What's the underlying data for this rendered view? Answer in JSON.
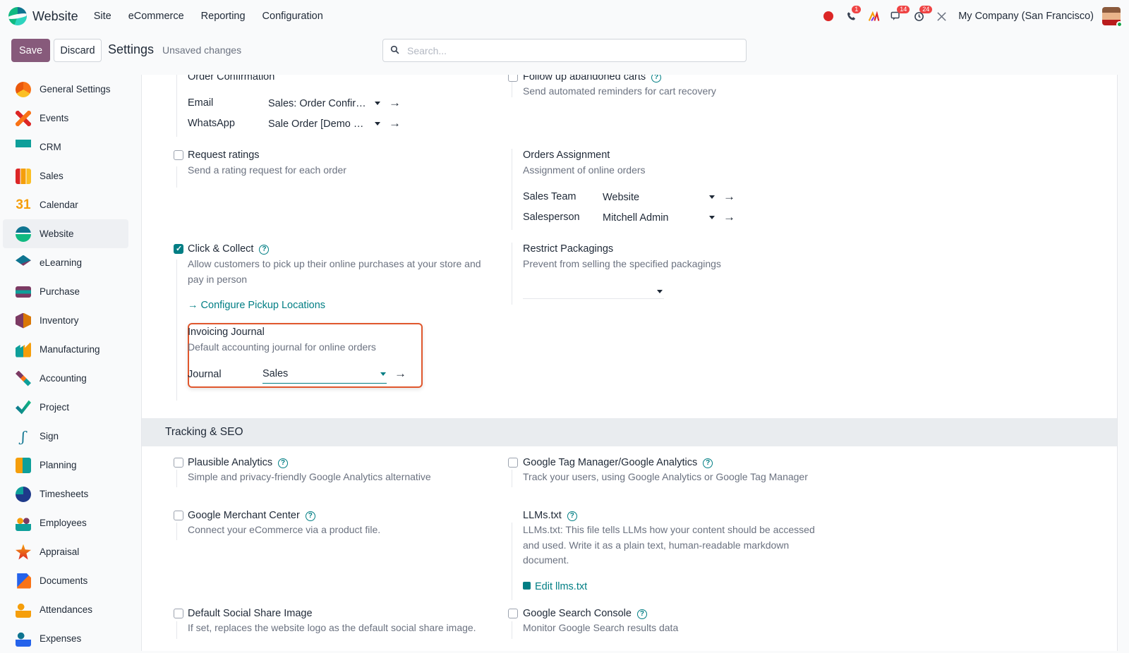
{
  "navbar": {
    "app_name": "Website",
    "menu": [
      "Site",
      "eCommerce",
      "Reporting",
      "Configuration"
    ],
    "badges": {
      "phone": "1",
      "messages": "14",
      "activities": "24"
    },
    "company": "My Company (San Francisco)"
  },
  "control_panel": {
    "save_label": "Save",
    "discard_label": "Discard",
    "title": "Settings",
    "status": "Unsaved changes",
    "search_placeholder": "Search..."
  },
  "sidebar": {
    "items": [
      {
        "label": "General Settings",
        "icon": "general-settings-icon",
        "color": "#f97316"
      },
      {
        "label": "Events",
        "icon": "events-icon",
        "color": "#f97316"
      },
      {
        "label": "CRM",
        "icon": "crm-icon",
        "color": "#0e9f9a"
      },
      {
        "label": "Sales",
        "icon": "sales-icon",
        "color": "#f59e0b"
      },
      {
        "label": "Calendar",
        "icon": "calendar-icon",
        "color": "#f59e0b"
      },
      {
        "label": "Website",
        "icon": "website-icon",
        "color": "#10b981",
        "active": true
      },
      {
        "label": "eLearning",
        "icon": "elearning-icon",
        "color": "#0e7490"
      },
      {
        "label": "Purchase",
        "icon": "purchase-icon",
        "color": "#7c3a63"
      },
      {
        "label": "Inventory",
        "icon": "inventory-icon",
        "color": "#d97706"
      },
      {
        "label": "Manufacturing",
        "icon": "manufacturing-icon",
        "color": "#0e9f9a"
      },
      {
        "label": "Accounting",
        "icon": "accounting-icon",
        "color": "#f97316"
      },
      {
        "label": "Project",
        "icon": "project-icon",
        "color": "#10b981"
      },
      {
        "label": "Sign",
        "icon": "sign-icon",
        "color": "#0e7490"
      },
      {
        "label": "Planning",
        "icon": "planning-icon",
        "color": "#f59e0b"
      },
      {
        "label": "Timesheets",
        "icon": "timesheets-icon",
        "color": "#1e3a8a"
      },
      {
        "label": "Employees",
        "icon": "employees-icon",
        "color": "#7c3a63"
      },
      {
        "label": "Appraisal",
        "icon": "appraisal-icon",
        "color": "#f59e0b"
      },
      {
        "label": "Documents",
        "icon": "documents-icon",
        "color": "#f97316"
      },
      {
        "label": "Attendances",
        "icon": "attendances-icon",
        "color": "#f59e0b"
      },
      {
        "label": "Expenses",
        "icon": "expenses-icon",
        "color": "#0e7490"
      }
    ]
  },
  "settings": {
    "order_confirmation": {
      "title": "Order Confirmation",
      "email_label": "Email",
      "email_value": "Sales: Order Confir…",
      "whatsapp_label": "WhatsApp",
      "whatsapp_value": "Sale Order [Demo …"
    },
    "abandoned_carts": {
      "title": "Follow up abandoned carts",
      "desc": "Send automated reminders for cart recovery",
      "checked": false
    },
    "request_ratings": {
      "title": "Request ratings",
      "desc": "Send a rating request for each order",
      "checked": false
    },
    "orders_assignment": {
      "title": "Orders Assignment",
      "desc": "Assignment of online orders",
      "team_label": "Sales Team",
      "team_value": "Website",
      "salesperson_label": "Salesperson",
      "salesperson_value": "Mitchell Admin"
    },
    "click_collect": {
      "title": "Click & Collect",
      "desc": "Allow customers to pick up their online purchases at your store and pay in person",
      "link": "Configure Pickup Locations",
      "checked": true
    },
    "restrict_packagings": {
      "title": "Restrict Packagings",
      "desc": "Prevent from selling the specified packagings"
    },
    "invoicing_journal": {
      "title": "Invoicing Journal",
      "desc": "Default accounting journal for online orders",
      "journal_label": "Journal",
      "journal_value": "Sales"
    },
    "tracking_section": "Tracking & SEO",
    "plausible": {
      "title": "Plausible Analytics",
      "desc": "Simple and privacy-friendly Google Analytics alternative",
      "checked": false
    },
    "gtm": {
      "title": "Google Tag Manager/Google Analytics",
      "desc": "Track your users, using Google Analytics or Google Tag Manager",
      "checked": false
    },
    "merchant": {
      "title": "Google Merchant Center",
      "desc": "Connect your eCommerce via a product file.",
      "checked": false
    },
    "llms": {
      "title": "LLMs.txt",
      "desc": "LLMs.txt: This file tells LLMs how your content should be accessed and used. Write it as a plain text, human-readable markdown document.",
      "link": "Edit llms.txt"
    },
    "social_share": {
      "title": "Default Social Share Image",
      "desc": "If set, replaces the website logo as the default social share image.",
      "checked": false
    },
    "search_console": {
      "title": "Google Search Console",
      "desc": "Monitor Google Search results data",
      "checked": false
    }
  },
  "colors": {
    "primary": "#875a7b",
    "accent": "#017e84",
    "highlight": "#e0572d"
  }
}
